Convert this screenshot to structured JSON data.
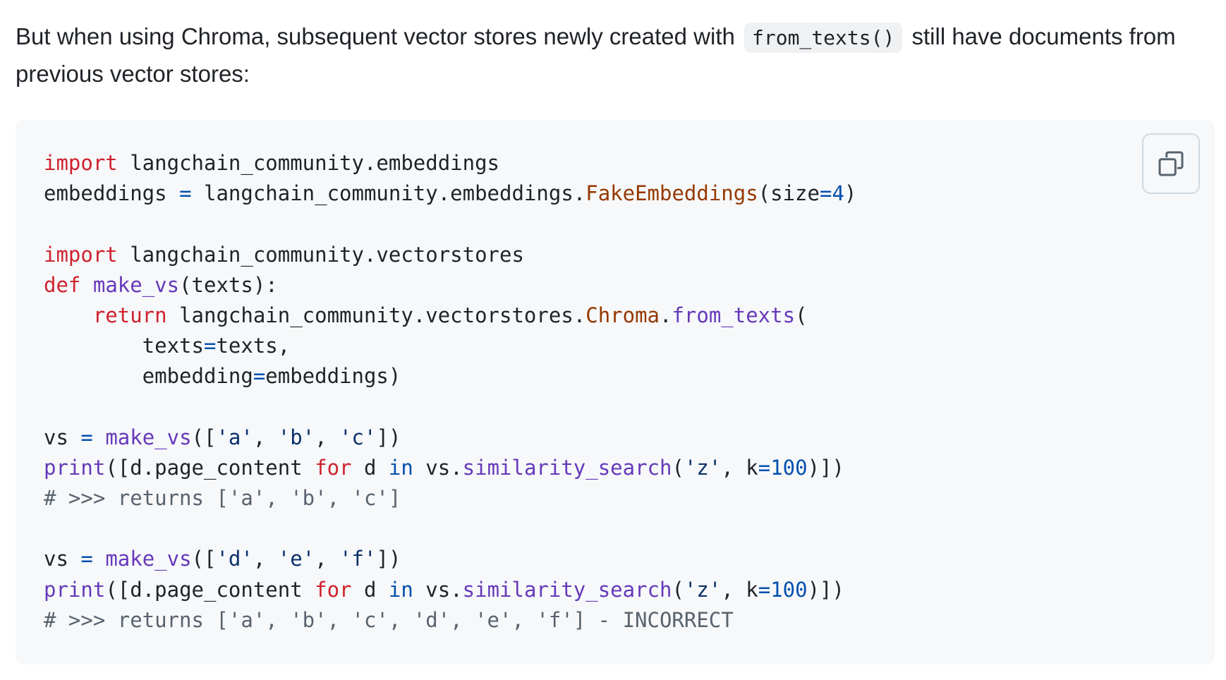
{
  "paragraph": {
    "before_code": "But when using Chroma, subsequent vector stores newly created with",
    "inline_code": "from_texts()",
    "after_code": "still have documents from previous vector stores:"
  },
  "code_block": {
    "copy_icon": "copy-icon",
    "lines": [
      [
        {
          "t": "import",
          "c": "kw"
        },
        {
          "t": " langchain_community.embeddings",
          "c": ""
        }
      ],
      [
        {
          "t": "embeddings ",
          "c": ""
        },
        {
          "t": "=",
          "c": "op"
        },
        {
          "t": " langchain_community.embeddings.",
          "c": ""
        },
        {
          "t": "FakeEmbeddings",
          "c": "cls"
        },
        {
          "t": "(size",
          "c": ""
        },
        {
          "t": "=",
          "c": "op"
        },
        {
          "t": "4",
          "c": "num"
        },
        {
          "t": ")",
          "c": ""
        }
      ],
      [],
      [
        {
          "t": "import",
          "c": "kw"
        },
        {
          "t": " langchain_community.vectorstores",
          "c": ""
        }
      ],
      [
        {
          "t": "def",
          "c": "kw"
        },
        {
          "t": " ",
          "c": ""
        },
        {
          "t": "make_vs",
          "c": "fn"
        },
        {
          "t": "(texts):",
          "c": ""
        }
      ],
      [
        {
          "t": "    ",
          "c": ""
        },
        {
          "t": "return",
          "c": "kw"
        },
        {
          "t": " langchain_community.vectorstores.",
          "c": ""
        },
        {
          "t": "Chroma",
          "c": "cls"
        },
        {
          "t": ".",
          "c": ""
        },
        {
          "t": "from_texts",
          "c": "fn"
        },
        {
          "t": "(",
          "c": ""
        }
      ],
      [
        {
          "t": "        texts",
          "c": ""
        },
        {
          "t": "=",
          "c": "op"
        },
        {
          "t": "texts,",
          "c": ""
        }
      ],
      [
        {
          "t": "        embedding",
          "c": ""
        },
        {
          "t": "=",
          "c": "op"
        },
        {
          "t": "embeddings)",
          "c": ""
        }
      ],
      [],
      [
        {
          "t": "vs ",
          "c": ""
        },
        {
          "t": "=",
          "c": "op"
        },
        {
          "t": " ",
          "c": ""
        },
        {
          "t": "make_vs",
          "c": "fn"
        },
        {
          "t": "([",
          "c": ""
        },
        {
          "t": "'a'",
          "c": "str"
        },
        {
          "t": ", ",
          "c": ""
        },
        {
          "t": "'b'",
          "c": "str"
        },
        {
          "t": ", ",
          "c": ""
        },
        {
          "t": "'c'",
          "c": "str"
        },
        {
          "t": "])",
          "c": ""
        }
      ],
      [
        {
          "t": "print",
          "c": "fn"
        },
        {
          "t": "([d.page_content ",
          "c": ""
        },
        {
          "t": "for",
          "c": "kw"
        },
        {
          "t": " d ",
          "c": ""
        },
        {
          "t": "in",
          "c": "op"
        },
        {
          "t": " vs.",
          "c": ""
        },
        {
          "t": "similarity_search",
          "c": "fn"
        },
        {
          "t": "(",
          "c": ""
        },
        {
          "t": "'z'",
          "c": "str"
        },
        {
          "t": ", k",
          "c": ""
        },
        {
          "t": "=",
          "c": "op"
        },
        {
          "t": "100",
          "c": "num"
        },
        {
          "t": ")])",
          "c": ""
        }
      ],
      [
        {
          "t": "# >>> returns ['a', 'b', 'c']",
          "c": "cm"
        }
      ],
      [],
      [
        {
          "t": "vs ",
          "c": ""
        },
        {
          "t": "=",
          "c": "op"
        },
        {
          "t": " ",
          "c": ""
        },
        {
          "t": "make_vs",
          "c": "fn"
        },
        {
          "t": "([",
          "c": ""
        },
        {
          "t": "'d'",
          "c": "str"
        },
        {
          "t": ", ",
          "c": ""
        },
        {
          "t": "'e'",
          "c": "str"
        },
        {
          "t": ", ",
          "c": ""
        },
        {
          "t": "'f'",
          "c": "str"
        },
        {
          "t": "])",
          "c": ""
        }
      ],
      [
        {
          "t": "print",
          "c": "fn"
        },
        {
          "t": "([d.page_content ",
          "c": ""
        },
        {
          "t": "for",
          "c": "kw"
        },
        {
          "t": " d ",
          "c": ""
        },
        {
          "t": "in",
          "c": "op"
        },
        {
          "t": " vs.",
          "c": ""
        },
        {
          "t": "similarity_search",
          "c": "fn"
        },
        {
          "t": "(",
          "c": ""
        },
        {
          "t": "'z'",
          "c": "str"
        },
        {
          "t": ", k",
          "c": ""
        },
        {
          "t": "=",
          "c": "op"
        },
        {
          "t": "100",
          "c": "num"
        },
        {
          "t": ")])",
          "c": ""
        }
      ],
      [
        {
          "t": "# >>> returns ['a', 'b', 'c', 'd', 'e', 'f'] - INCORRECT",
          "c": "cm"
        }
      ]
    ]
  },
  "colors": {
    "text": "#1f2328",
    "code_background": "#f6f8fa",
    "inline_code_background": "#eff1f3",
    "keyword": "#cf222e",
    "function": "#6639ba",
    "class": "#953800",
    "operator": "#0550ae",
    "string": "#0a3069",
    "comment": "#59636e"
  }
}
